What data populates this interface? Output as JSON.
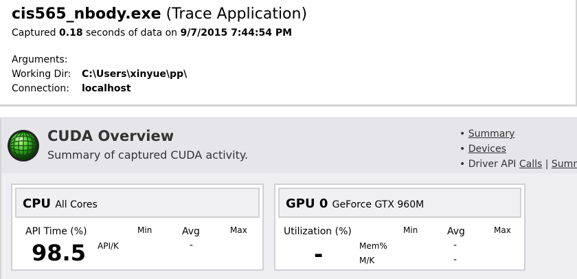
{
  "header": {
    "exe_name": "cis565_nbody.exe",
    "app_type": "(Trace Application)",
    "captured_prefix": "Captured",
    "captured_seconds": "0.18",
    "captured_mid": "seconds of data on",
    "captured_datetime": "9/7/2015 7:44:54 PM",
    "arguments_label": "Arguments:",
    "arguments_value": "",
    "working_dir_label": "Working Dir:",
    "working_dir_value": "C:\\Users\\xinyue\\pp\\",
    "connection_label": "Connection:",
    "connection_value": "localhost"
  },
  "overview": {
    "title": "CUDA Overview",
    "subtitle": "Summary of captured CUDA activity.",
    "links": {
      "summary": "Summary",
      "devices": "Devices",
      "driver_api_prefix": "Driver API",
      "calls": "Calls",
      "separator": "|",
      "summ": "Summ"
    }
  },
  "cpu_panel": {
    "title": "CPU",
    "subtitle": "All Cores",
    "api_time_label": "API Time (%)",
    "min_label": "Min",
    "avg_label": "Avg",
    "max_label": "Max",
    "api_time_value": "98.5",
    "api_k_label": "API/K",
    "api_k_avg": "-"
  },
  "gpu_panel": {
    "title": "GPU 0",
    "subtitle": "GeForce GTX 960M",
    "utilization_label": "Utilization (%)",
    "min_label": "Min",
    "avg_label": "Avg",
    "max_label": "Max",
    "utilization_value": "-",
    "mem_label": "Mem%",
    "mem_avg": "-",
    "mk_label": "M/K",
    "mk_avg": "-"
  },
  "colors": {
    "globe": "#3fb82c",
    "border": "#d0d0d4",
    "band": "#e6e6ea"
  }
}
